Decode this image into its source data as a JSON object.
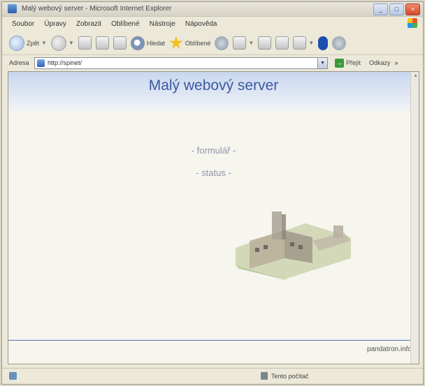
{
  "window": {
    "title": "Malý webový server - Microsoft Internet Explorer"
  },
  "menu": [
    "Soubor",
    "Úpravy",
    "Zobrazit",
    "Oblíbené",
    "Nástroje",
    "Nápověda"
  ],
  "toolbar": {
    "back_label": "Zpět",
    "search_label": "Hledat",
    "favorites_label": "Oblíbené"
  },
  "address": {
    "label": "Adresa",
    "url": "http://spinet/",
    "go_label": "Přejít",
    "links_label": "Odkazy",
    "more": "»"
  },
  "page": {
    "title": "Malý webový server",
    "links": [
      "- formulář -",
      "- status -"
    ],
    "footer": "pandatron.info"
  },
  "status": {
    "zone": "Tento počítač"
  },
  "colors": {
    "title": "#3a5aa0",
    "link": "#8f93ad",
    "footer_line": "#5570a8"
  }
}
